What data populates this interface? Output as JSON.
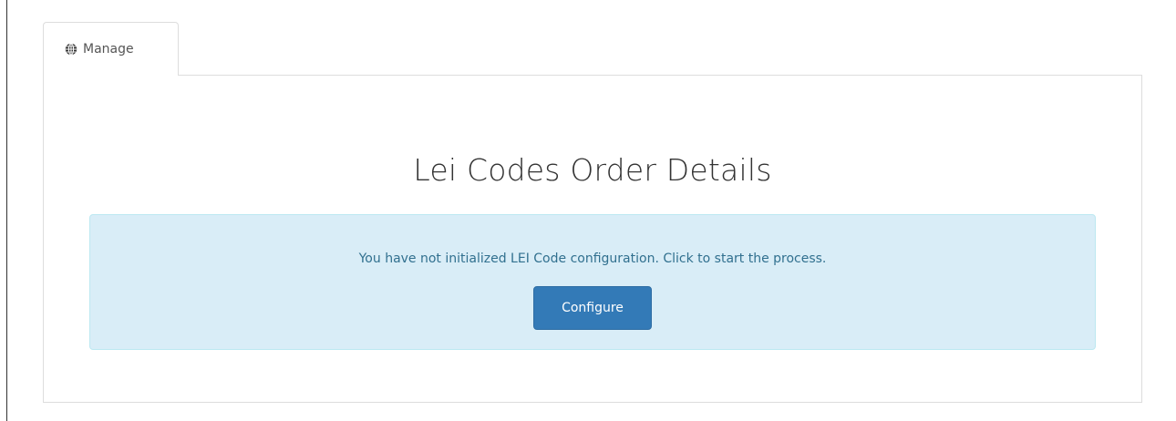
{
  "tabs": [
    {
      "label": "Manage",
      "icon": "globe-icon",
      "active": true
    }
  ],
  "main": {
    "title": "Lei Codes Order Details",
    "alert": {
      "message": "You have not initialized LEI Code configuration. Click to start the process.",
      "button_label": "Configure"
    }
  },
  "colors": {
    "alert_background": "#d9edf7",
    "alert_text": "#31708f",
    "primary_button": "#337ab7"
  }
}
